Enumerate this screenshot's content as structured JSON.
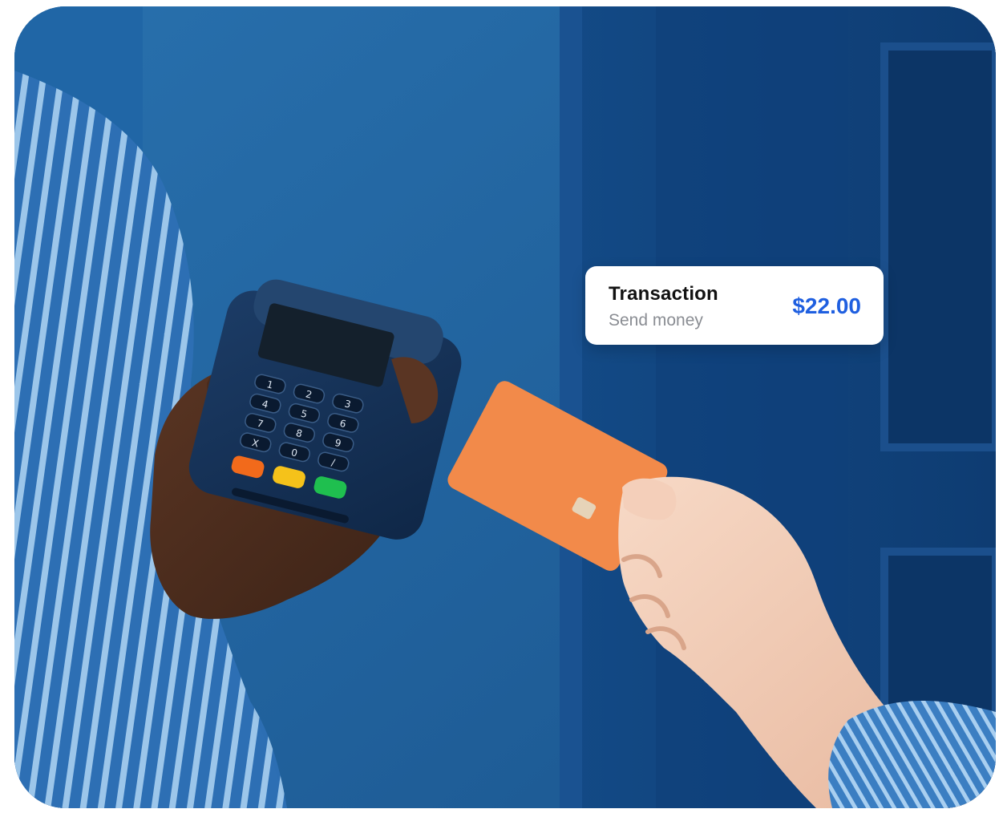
{
  "transaction_card": {
    "title": "Transaction",
    "subtitle": "Send money",
    "amount": "$22.00"
  },
  "terminal": {
    "keypad_keys": [
      "1",
      "2",
      "3",
      "4",
      "5",
      "6",
      "7",
      "8",
      "9",
      "X",
      "0",
      "/"
    ],
    "button_colors": [
      "#f26a1b",
      "#f5c21a",
      "#1fbf4f"
    ]
  },
  "colors": {
    "background_blue": "#1e5e98",
    "door_blue": "#0f3f7a",
    "card_orange": "#f28a4a",
    "amount_blue": "#1f5fe0"
  }
}
